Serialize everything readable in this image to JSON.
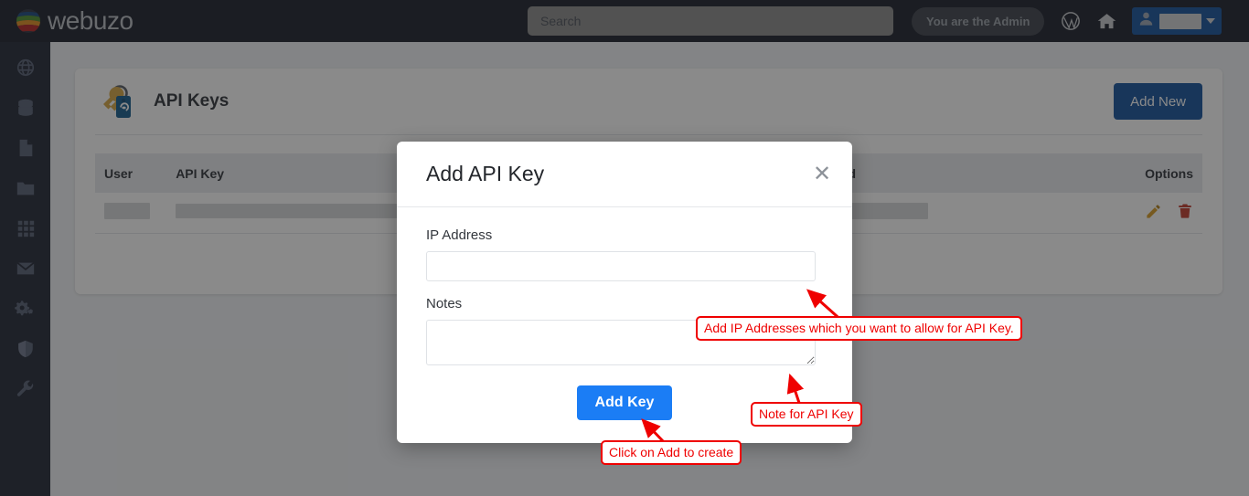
{
  "topbar": {
    "brand": "webuzo",
    "search": {
      "value": "",
      "placeholder": "Search"
    },
    "admin_pill": "You are the Admin",
    "icons": [
      "wordpress-icon",
      "home-icon"
    ],
    "user_menu": {
      "redacted": true
    }
  },
  "sidebar": {
    "items": [
      {
        "name": "sidebar-item-domains",
        "icon": "globe-icon"
      },
      {
        "name": "sidebar-item-databases",
        "icon": "database-icon"
      },
      {
        "name": "sidebar-item-files",
        "icon": "file-icon"
      },
      {
        "name": "sidebar-item-folders",
        "icon": "folder-icon"
      },
      {
        "name": "sidebar-item-apps",
        "icon": "grid-icon"
      },
      {
        "name": "sidebar-item-mail",
        "icon": "envelope-icon"
      },
      {
        "name": "sidebar-item-settings",
        "icon": "gears-icon"
      },
      {
        "name": "sidebar-item-security",
        "icon": "shield-icon"
      },
      {
        "name": "sidebar-item-tools",
        "icon": "wrench-icon"
      }
    ]
  },
  "page": {
    "title": "API Keys",
    "title_icon": "key-tag-icon",
    "add_new_label": "Add New",
    "table": {
      "columns": [
        "User",
        "API Key",
        "Created",
        "Options"
      ],
      "rows": [
        {
          "user": "",
          "api_key": "",
          "created": "",
          "options": [
            "edit-icon",
            "delete-icon"
          ],
          "redacted": true
        }
      ]
    }
  },
  "modal": {
    "title": "Add API Key",
    "close_icon": "close-icon",
    "fields": {
      "ip_address": {
        "label": "IP Address",
        "value": "",
        "placeholder": ""
      },
      "notes": {
        "label": "Notes",
        "value": "",
        "placeholder": ""
      }
    },
    "submit_label": "Add Key"
  },
  "annotations": [
    {
      "id": "anno-ip-address",
      "text": "Add IP Addresses which you want to allow for API Key."
    },
    {
      "id": "anno-notes",
      "text": "Note for API Key"
    },
    {
      "id": "anno-add-key",
      "text": "Click on Add to create"
    }
  ],
  "colors": {
    "topbar_bg": "#171c28",
    "sidebar_bg": "#1f2433",
    "primary_blue": "#12509b",
    "action_blue": "#1b7df5",
    "annotation_red": "#ef0000",
    "edit_icon": "#d79b22",
    "delete_icon": "#c0392b"
  }
}
